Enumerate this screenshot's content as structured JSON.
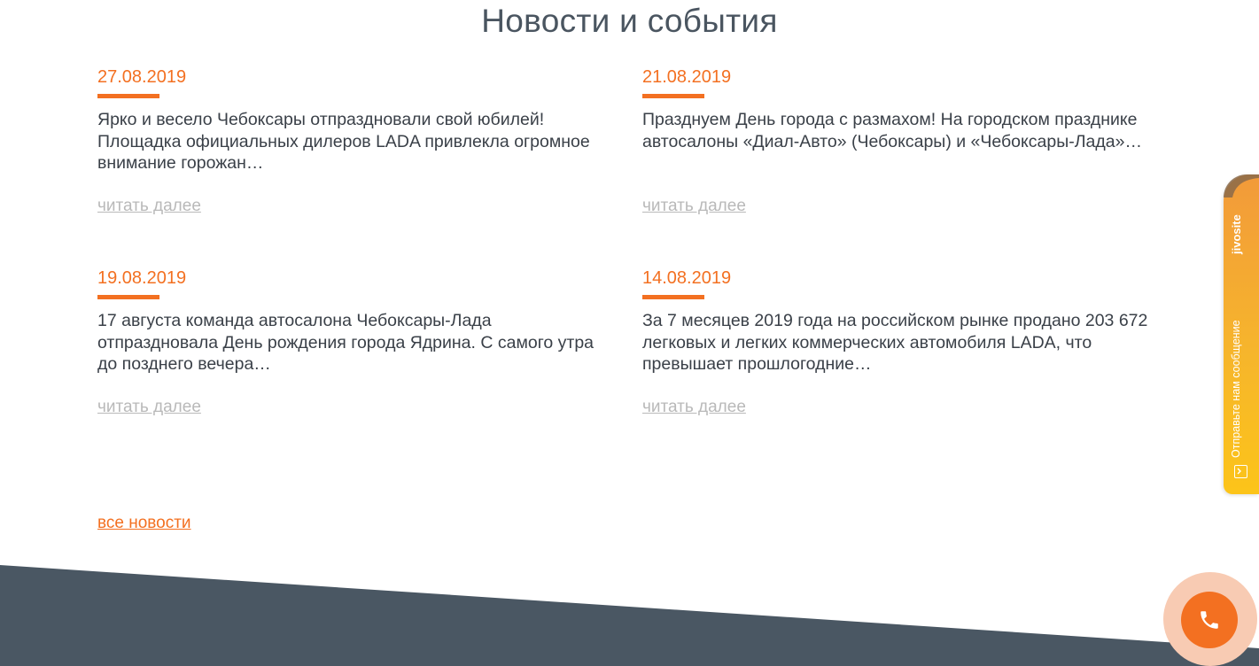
{
  "section": {
    "title": "Новости и события"
  },
  "news": [
    {
      "date": "27.08.2019",
      "text": "Ярко и весело Чебоксары отпраздновали свой юбилей! Площадка официальных дилеров LADA привлекла огромное внимание горожан…",
      "more": "читать далее"
    },
    {
      "date": "21.08.2019",
      "text": "Празднуем День города с размахом! На городском празднике автосалоны «Диал-Авто» (Чебоксары) и «Чебоксары-Лада»…",
      "more": "читать далее"
    },
    {
      "date": "19.08.2019",
      "text": "17 августа команда автосалона Чебоксары-Лада отпраздновала День рождения города Ядрина. С самого утра до позднего вечера…",
      "more": "читать далее"
    },
    {
      "date": "14.08.2019",
      "text": "За 7 месяцев 2019 года на российском рынке продано 203 672 легковых и легких коммерческих автомобиля LADA, что превышает прошлогодние…",
      "more": "читать далее"
    }
  ],
  "all_news": "все новости",
  "jivo": {
    "brand": "jivosite",
    "label": "Отправьте нам сообщение"
  },
  "colors": {
    "accent": "#f37021",
    "footer": "#4a5763",
    "muted_link": "#b9b9b9",
    "title": "#4a5560"
  },
  "icons": {
    "call": "phone-icon",
    "message": "message-icon"
  }
}
